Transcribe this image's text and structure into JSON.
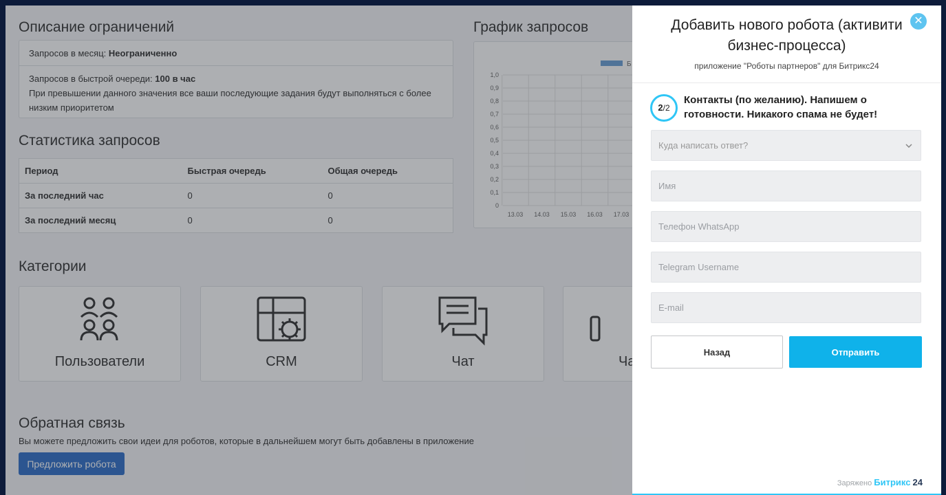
{
  "limits": {
    "title": "Описание ограничений",
    "monthly_label": "Запросов в месяц:",
    "monthly_value": "Неограниченно",
    "fast_label": "Запросов в быстрой очереди:",
    "fast_value": "100 в час",
    "note": "При превышении данного значения все ваши последующие задания будут выполняться с более низким приоритетом"
  },
  "stats": {
    "title": "Статистика запросов",
    "columns": [
      "Период",
      "Быстрая очередь",
      "Общая очередь"
    ],
    "rows": [
      {
        "period": "За последний час",
        "fast": "0",
        "common": "0"
      },
      {
        "period": "За последний месяц",
        "fast": "0",
        "common": "0"
      }
    ]
  },
  "chart": {
    "title": "График запросов",
    "legend_label": "Б",
    "series_color": "#6a9ed6"
  },
  "chart_data": {
    "type": "bar",
    "categories": [
      "13.03",
      "14.03",
      "15.03",
      "16.03",
      "17.03"
    ],
    "values": [
      0,
      0,
      0,
      0,
      0
    ],
    "ylim": [
      0,
      1.0
    ],
    "yticks": [
      "1,0",
      "0,9",
      "0,8",
      "0,7",
      "0,6",
      "0,5",
      "0,4",
      "0,3",
      "0,2",
      "0,1",
      "0"
    ],
    "grid": true,
    "legend_placement": "top"
  },
  "categories": {
    "title": "Категории",
    "items": [
      {
        "label": "Пользователи",
        "icon": "users-icon"
      },
      {
        "label": "CRM",
        "icon": "crm-icon"
      },
      {
        "label": "Чат",
        "icon": "chat-icon"
      },
      {
        "label": "Ча",
        "icon": "phone-icon"
      }
    ]
  },
  "feedback": {
    "title": "Обратная связь",
    "text": "Вы можете предложить свои идеи для роботов, которые в дальнейшем могут быть добавлены в приложение",
    "button": "Предложить робота"
  },
  "panel": {
    "title": "Добавить нового робота (активити бизнес-процесса)",
    "subtitle": "приложение \"Роботы партнеров\" для Битрикс24",
    "step_current": "2",
    "step_total": "/2",
    "step_text": "Контакты (по желанию). Напишем о готовности. Никакого спама не будет!",
    "select_placeholder": "Куда написать ответ?",
    "name_placeholder": "Имя",
    "whatsapp_placeholder": "Телефон WhatsApp",
    "telegram_placeholder": "Telegram Username",
    "email_placeholder": "E-mail",
    "back_button": "Назад",
    "send_button": "Отправить",
    "powered_label": "Заряжено",
    "powered_brand": "Битрикс",
    "powered_num": "24",
    "accent": "#2fc6f6",
    "button_color": "#0fb2ea"
  }
}
